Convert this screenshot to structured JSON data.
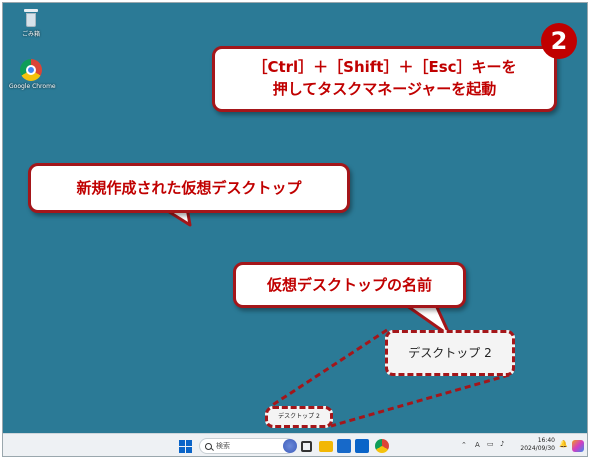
{
  "desktop": {
    "icons": [
      {
        "label": "ごみ箱",
        "icon": "recycle-bin-icon"
      },
      {
        "label": "Google Chrome",
        "icon": "chrome-icon"
      }
    ],
    "background": "#2b7a96"
  },
  "annotations": {
    "step_number": "2",
    "shortcut_line1": "［Ctrl］＋［Shift］＋［Esc］キーを",
    "shortcut_line2": "押してタスクマネージャーを起動",
    "new_desktop": "新規作成された仮想デスクトップ",
    "desktop_name": "仮想デスクトップの名前",
    "accent": "#c00000"
  },
  "virtual_desktop": {
    "label": "デスクトップ 2"
  },
  "taskbar": {
    "search_placeholder": "検索",
    "ime": "A",
    "time": "16:40",
    "date": "2024/09/30",
    "apps": [
      "copilot-icon",
      "task-view-icon",
      "file-explorer-icon",
      "store-icon",
      "outlook-icon",
      "chrome-icon"
    ]
  }
}
